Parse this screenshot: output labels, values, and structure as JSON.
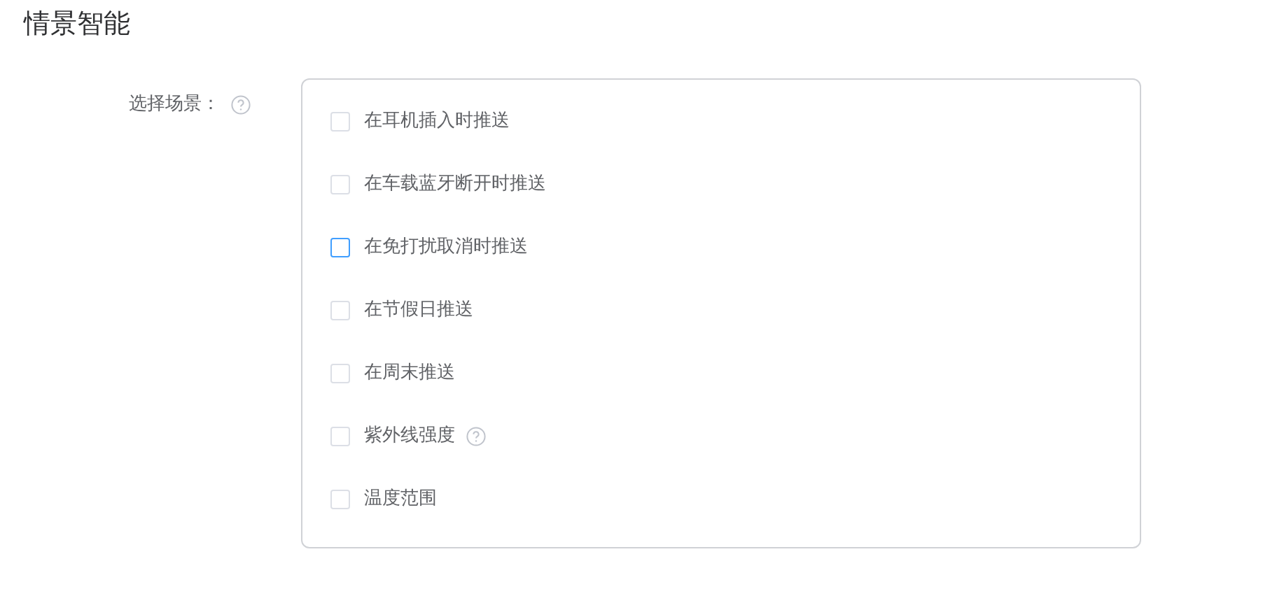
{
  "title": "情景智能",
  "field": {
    "label": "选择场景：",
    "help": true
  },
  "options": [
    {
      "label": "在耳机插入时推送",
      "checked": false,
      "focused": false,
      "help": false
    },
    {
      "label": "在车载蓝牙断开时推送",
      "checked": false,
      "focused": false,
      "help": false
    },
    {
      "label": "在免打扰取消时推送",
      "checked": false,
      "focused": true,
      "help": false
    },
    {
      "label": "在节假日推送",
      "checked": false,
      "focused": false,
      "help": false
    },
    {
      "label": "在周末推送",
      "checked": false,
      "focused": false,
      "help": false
    },
    {
      "label": "紫外线强度",
      "checked": false,
      "focused": false,
      "help": true
    },
    {
      "label": "温度范围",
      "checked": false,
      "focused": false,
      "help": false
    }
  ]
}
